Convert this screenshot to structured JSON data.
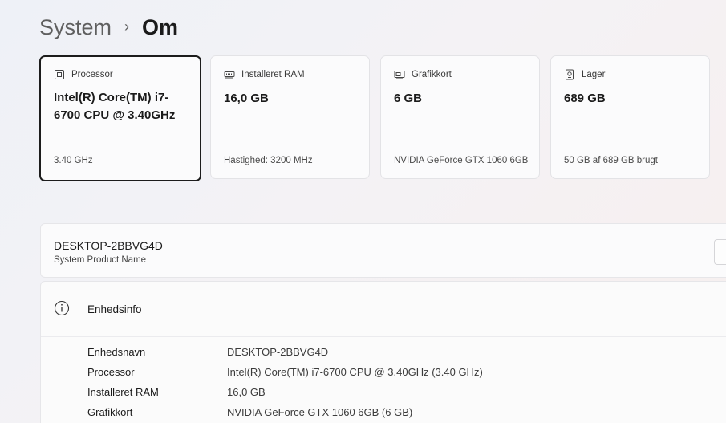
{
  "breadcrumb": {
    "parent": "System",
    "separator": "›",
    "current": "Om"
  },
  "cards": [
    {
      "label": "Processor",
      "icon": "processor-icon",
      "value": "Intel(R) Core(TM) i7-6700 CPU @ 3.40GHz",
      "sub": "3.40 GHz"
    },
    {
      "label": "Installeret RAM",
      "icon": "ram-icon",
      "value": "16,0 GB",
      "sub": "Hastighed: 3200 MHz"
    },
    {
      "label": "Grafikkort",
      "icon": "graphics-card-icon",
      "value": "6 GB",
      "sub": "NVIDIA GeForce GTX 1060 6GB"
    },
    {
      "label": "Lager",
      "icon": "storage-icon",
      "value": "689 GB",
      "sub": "50 GB af 689 GB brugt"
    }
  ],
  "device": {
    "name": "DESKTOP-2BBVG4D",
    "sub": "System Product Name"
  },
  "info": {
    "title": "Enhedsinfo",
    "rows": [
      {
        "label": "Enhedsnavn",
        "value": "DESKTOP-2BBVG4D"
      },
      {
        "label": "Processor",
        "value": "Intel(R) Core(TM) i7-6700 CPU @ 3.40GHz (3.40 GHz)"
      },
      {
        "label": "Installeret RAM",
        "value": "16,0 GB"
      },
      {
        "label": "Grafikkort",
        "value": "NVIDIA GeForce GTX 1060 6GB (6 GB)"
      }
    ]
  }
}
